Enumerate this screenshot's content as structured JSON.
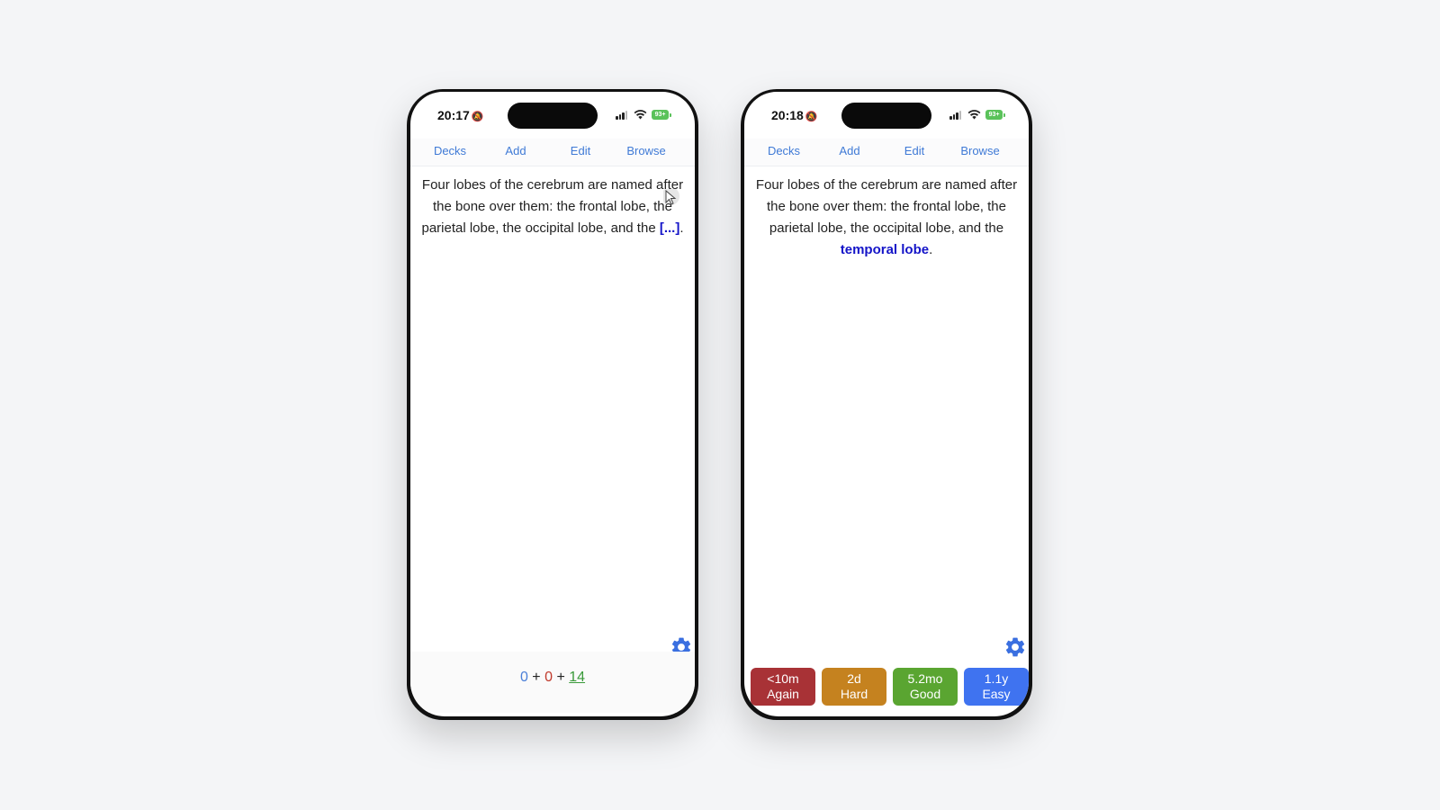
{
  "screens": [
    {
      "time": "20:17",
      "battery": "93+",
      "nav": [
        "Decks",
        "Add",
        "Edit",
        "Browse"
      ],
      "card_text": "Four lobes of the cerebrum are named after the bone over them: the frontal lobe, the parietal lobe, the occipital lobe, and the ",
      "cloze": "[...]",
      "card_end": ".",
      "counts": {
        "new": "0",
        "plus1": "+",
        "learn": "0",
        "plus2": "+",
        "review": "14"
      }
    },
    {
      "time": "20:18",
      "battery": "93+",
      "nav": [
        "Decks",
        "Add",
        "Edit",
        "Browse"
      ],
      "card_text": "Four lobes of the cerebrum are named after the bone over them: the frontal lobe, the parietal lobe, the occipital lobe, and the ",
      "cloze": "temporal lobe",
      "card_end": ".",
      "answers": [
        {
          "interval": "<10m",
          "label": "Again",
          "color": "#a83236"
        },
        {
          "interval": "2d",
          "label": "Hard",
          "color": "#c5821f"
        },
        {
          "interval": "5.2mo",
          "label": "Good",
          "color": "#5aa531"
        },
        {
          "interval": "1.1y",
          "label": "Easy",
          "color": "#3f73f0"
        }
      ]
    }
  ],
  "icons": {
    "bell": "bell-slash-icon",
    "signal": "cellular-signal-icon",
    "wifi": "wifi-icon",
    "battery": "battery-icon",
    "gear": "gear-icon",
    "cursor": "mouse-cursor-icon"
  },
  "colors": {
    "link": "#3f7ad6",
    "cloze": "#1414c8",
    "gear": "#3a6fe0",
    "count_new": "#4a7fd8",
    "count_learn": "#c0392b",
    "count_review": "#3a9a3a"
  }
}
